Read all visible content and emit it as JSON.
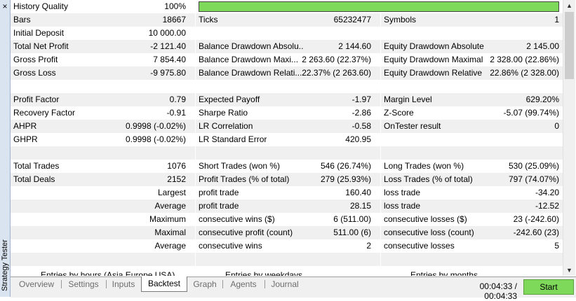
{
  "sidebar": {
    "close_label": "×",
    "title": "Strategy Tester"
  },
  "rows": [
    {
      "alt": false,
      "c": [
        "History Quality",
        "100%",
        "",
        "",
        "",
        ""
      ],
      "bar": true
    },
    {
      "alt": true,
      "c": [
        "Bars",
        "18667",
        "Ticks",
        "65232477",
        "Symbols",
        "1"
      ]
    },
    {
      "alt": false,
      "c": [
        "Initial Deposit",
        "10 000.00",
        "",
        "",
        "",
        ""
      ]
    },
    {
      "alt": true,
      "c": [
        "Total Net Profit",
        "-2 121.40",
        "Balance Drawdown Absolu...",
        "2 144.60",
        "Equity Drawdown Absolute",
        "2 145.00"
      ]
    },
    {
      "alt": false,
      "c": [
        "Gross Profit",
        "7 854.40",
        "Balance Drawdown Maxi...",
        "2 263.60 (22.37%)",
        "Equity Drawdown Maximal",
        "2 328.00 (22.86%)"
      ]
    },
    {
      "alt": true,
      "c": [
        "Gross Loss",
        "-9 975.80",
        "Balance Drawdown Relati...",
        "22.37% (2 263.60)",
        "Equity Drawdown Relative",
        "22.86% (2 328.00)"
      ]
    },
    {
      "alt": false,
      "c": [
        "",
        "",
        "",
        "",
        "",
        ""
      ]
    },
    {
      "alt": true,
      "c": [
        "Profit Factor",
        "0.79",
        "Expected Payoff",
        "-1.97",
        "Margin Level",
        "629.20%"
      ]
    },
    {
      "alt": false,
      "c": [
        "Recovery Factor",
        "-0.91",
        "Sharpe Ratio",
        "-2.86",
        "Z-Score",
        "-5.07 (99.74%)"
      ]
    },
    {
      "alt": true,
      "c": [
        "AHPR",
        "0.9998 (-0.02%)",
        "LR Correlation",
        "-0.58",
        "OnTester result",
        "0"
      ]
    },
    {
      "alt": false,
      "c": [
        "GHPR",
        "0.9998 (-0.02%)",
        "LR Standard Error",
        "420.95",
        "",
        ""
      ]
    },
    {
      "alt": true,
      "c": [
        "",
        "",
        "",
        "",
        "",
        ""
      ]
    },
    {
      "alt": false,
      "c": [
        "Total Trades",
        "1076",
        "Short Trades (won %)",
        "546 (26.74%)",
        "Long Trades (won %)",
        "530 (25.09%)"
      ]
    },
    {
      "alt": true,
      "c": [
        "Total Deals",
        "2152",
        "Profit Trades (% of total)",
        "279 (25.93%)",
        "Loss Trades (% of total)",
        "797 (74.07%)"
      ]
    },
    {
      "alt": false,
      "sub": true,
      "c": [
        "Largest",
        "",
        "profit trade",
        "160.40",
        "loss trade",
        "-34.20"
      ]
    },
    {
      "alt": true,
      "sub": true,
      "c": [
        "Average",
        "",
        "profit trade",
        "28.15",
        "loss trade",
        "-12.52"
      ]
    },
    {
      "alt": false,
      "sub": true,
      "c": [
        "Maximum",
        "",
        "consecutive wins ($)",
        "6 (511.00)",
        "consecutive losses ($)",
        "23 (-242.60)"
      ]
    },
    {
      "alt": true,
      "sub": true,
      "c": [
        "Maximal",
        "",
        "consecutive profit (count)",
        "511.00 (6)",
        "consecutive loss (count)",
        "-242.60 (23)"
      ]
    },
    {
      "alt": false,
      "sub": true,
      "c": [
        "Average",
        "",
        "consecutive wins",
        "2",
        "consecutive losses",
        "5"
      ]
    },
    {
      "alt": true,
      "c": [
        "",
        "",
        "",
        "",
        "",
        ""
      ]
    }
  ],
  "cut_labels": [
    "Entries by hours (Asia Europe USA)",
    "Entries by weekdays",
    "Entries by months"
  ],
  "tabs": [
    "Overview",
    "Settings",
    "Inputs",
    "Backtest",
    "Graph",
    "Agents",
    "Journal"
  ],
  "active_tab": "Backtest",
  "status": {
    "timer": "00:04:33 / 00:04:33",
    "start_label": "Start"
  },
  "scroll": {
    "up": "▲",
    "down": "▼"
  },
  "colors": {
    "quality_bar": "#7ed85a",
    "start_button": "#7ed85a",
    "alt_row": "#f0f0f0",
    "sidebar": "#dae4f0"
  }
}
